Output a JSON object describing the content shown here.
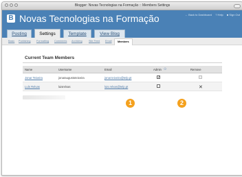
{
  "window": {
    "title": "Blogger: Novas Tecnologias na Formação :: Members Settings"
  },
  "header": {
    "blog_title": "Novas Tecnologias na Formação",
    "links": [
      "← Back to Dashboard",
      "? Help",
      "■ Sign Out"
    ]
  },
  "tabs": [
    {
      "label": "Posting",
      "active": false
    },
    {
      "label": "Settings",
      "active": true
    },
    {
      "label": "Template",
      "active": false
    },
    {
      "label": "View Blog",
      "active": false
    }
  ],
  "subtabs": [
    {
      "label": "Basic",
      "active": false
    },
    {
      "label": "Publishing",
      "active": false
    },
    {
      "label": "Formatting",
      "active": false
    },
    {
      "label": "Comments",
      "active": false
    },
    {
      "label": "Archiving",
      "active": false
    },
    {
      "label": "Site Feed",
      "active": false
    },
    {
      "label": "Email",
      "active": false
    },
    {
      "label": "Members",
      "active": true
    }
  ],
  "members": {
    "section_title": "Current Team Members",
    "columns": {
      "name": "Name",
      "username": "Username",
      "email": "Email",
      "admin": "Admin",
      "remove": "Remove"
    },
    "rows": [
      {
        "name": "Jonar Teixeira",
        "username": "jonaraugustoteixeira",
        "email": "jonar.teixeira@telp.pt",
        "admin": true,
        "removable": false
      },
      {
        "name": "Luís Relvas",
        "username": "luisrelvas",
        "email": "luis.relvas@telp.pt",
        "admin": false,
        "removable": true
      }
    ]
  },
  "callouts": [
    "1",
    "2"
  ],
  "colors": {
    "header_blue": "#4a81b6",
    "callout_orange": "#f4a11e",
    "link_blue": "#4b77a5"
  }
}
